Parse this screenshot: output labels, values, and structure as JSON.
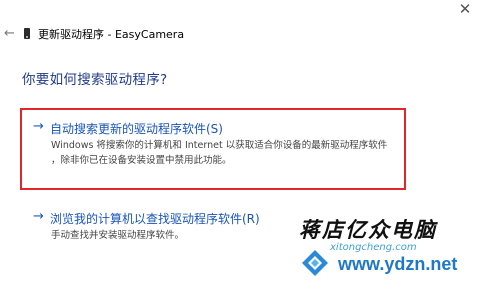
{
  "window": {
    "close_glyph": "✕"
  },
  "header": {
    "back_glyph": "←",
    "title": "更新驱动程序 - EasyCamera"
  },
  "heading": "你要如何搜索驱动程序?",
  "options": [
    {
      "arrow": "→",
      "title": "自动搜索更新的驱动程序软件(S)",
      "desc_line1": "Windows 将搜索你的计算机和 Internet 以获取适合你设备的最新驱动程序软件",
      "desc_line2": "，除非你已在设备安装设置中禁用此功能。"
    },
    {
      "arrow": "→",
      "title": "浏览我的计算机以查找驱动程序软件(R)",
      "desc_line1": "手动查找并安装驱动程序软件。"
    }
  ],
  "watermark": {
    "text": "蒋店亿众电脑",
    "sub": "xitongcheng.com",
    "url": "www.ydzn.net"
  },
  "colors": {
    "highlight_border": "#e0272a",
    "link_blue": "#1a55b8",
    "heading_blue": "#1f3c88"
  }
}
